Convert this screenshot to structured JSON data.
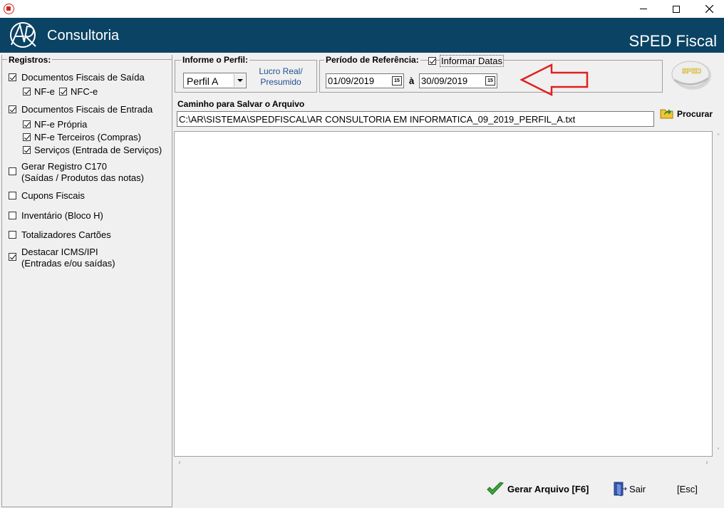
{
  "window": {
    "minimize_icon": "minimize-icon",
    "maximize_icon": "maximize-icon",
    "close_icon": "close-icon"
  },
  "header": {
    "logo_text": "Consultoria",
    "logo_mark_text": "AR",
    "title": "SPED Fiscal",
    "background": "#0b4364"
  },
  "registros": {
    "legend": "Registros:",
    "items": [
      {
        "label": "Documentos Fiscais de Saída",
        "checked": true
      },
      {
        "label": "NF-e",
        "checked": true
      },
      {
        "label": "NFC-e",
        "checked": true
      },
      {
        "label": "Documentos Fiscais de Entrada",
        "checked": true
      },
      {
        "label": "NF-e Própria",
        "checked": true
      },
      {
        "label": "NF-e Terceiros (Compras)",
        "checked": true
      },
      {
        "label": "Serviços (Entrada de Serviços)",
        "checked": true
      },
      {
        "label": "Gerar Registro C170",
        "label2": "(Saídas / Produtos das notas)",
        "checked": false
      },
      {
        "label": "Cupons Fiscais",
        "checked": false
      },
      {
        "label": "Inventário (Bloco H)",
        "checked": false
      },
      {
        "label": "Totalizadores Cartões",
        "checked": false
      },
      {
        "label": "Destacar ICMS/IPI",
        "label2": "(Entradas e/ou saídas)",
        "checked": true
      }
    ]
  },
  "perfil": {
    "legend": "Informe o Perfil:",
    "selected": "Perfil A",
    "description_line1": "Lucro Real/",
    "description_line2": "Presumido"
  },
  "periodo": {
    "legend": "Período de Referência:",
    "informar_datas_label": "Informar Datas",
    "informar_datas_checked": true,
    "start_date": "01/09/2019",
    "end_date": "30/09/2019",
    "separator": "à",
    "calendar_icon_text": "15"
  },
  "sped_logo_text": "SPED",
  "caminho": {
    "label": "Caminho para Salvar o Arquivo",
    "value": "C:\\AR\\SISTEMA\\SPEDFISCAL\\AR CONSULTORIA EM INFORMATICA_09_2019_PERFIL_A.txt",
    "browse_label": "Procurar"
  },
  "actions": {
    "gerar_label": "Gerar Arquivo [F6]",
    "sair_label": "Sair",
    "esc_label": "[Esc]"
  },
  "colors": {
    "annotation_arrow": "#e02020",
    "accent_text": "#1f4f8f"
  }
}
